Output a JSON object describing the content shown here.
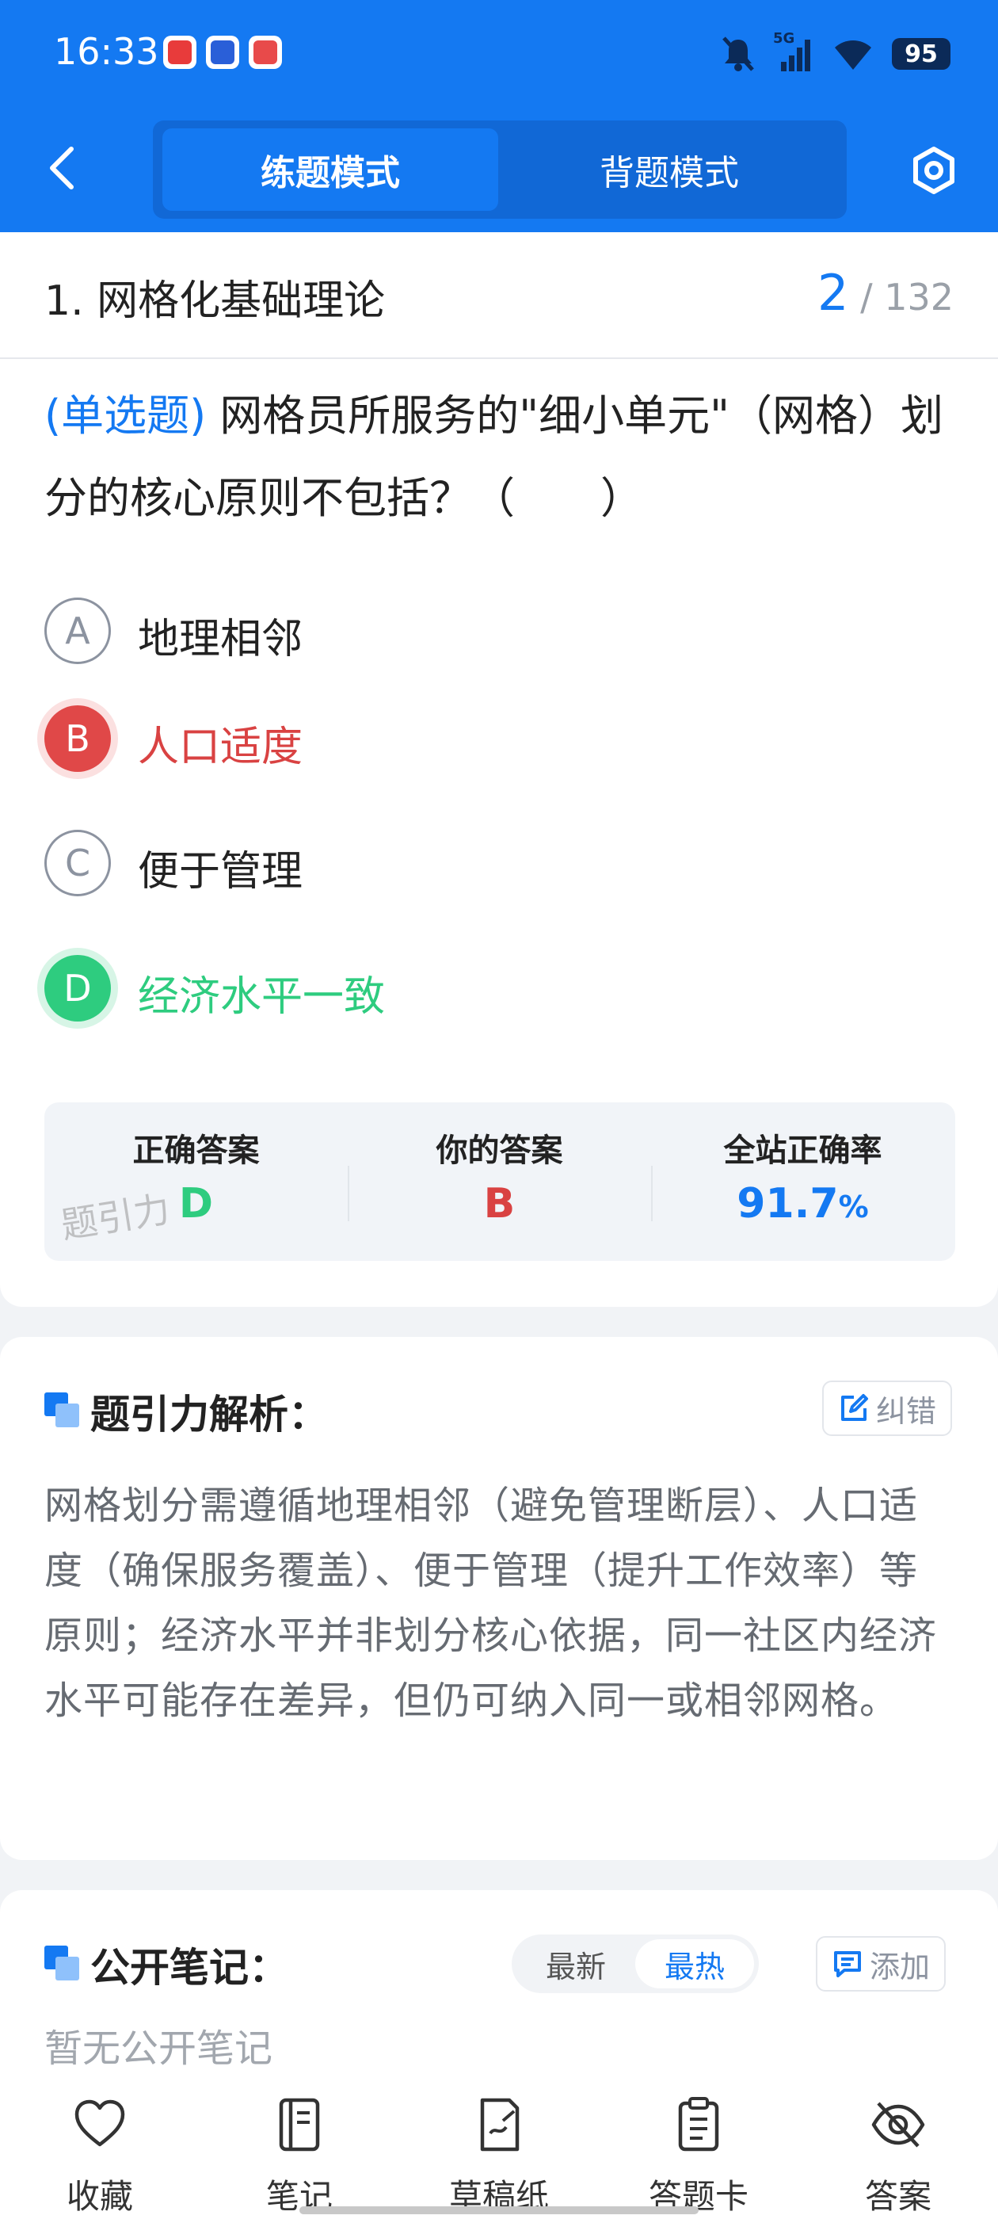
{
  "status_bar": {
    "time": "16:33",
    "network": "5G",
    "battery": "95"
  },
  "header": {
    "tabs": [
      "练题模式",
      "背题模式"
    ],
    "active_tab": "练题模式"
  },
  "section": {
    "title": "1. 网格化基础理论",
    "current": "2",
    "total": "132"
  },
  "question": {
    "type_label": "(单选题)",
    "text": "网格员所服务的\"细小单元\"（网格）划分的核心原则不包括？（　　）",
    "options": [
      {
        "letter": "A",
        "text": "地理相邻",
        "state": "normal"
      },
      {
        "letter": "B",
        "text": "人口适度",
        "state": "wrong"
      },
      {
        "letter": "C",
        "text": "便于管理",
        "state": "normal"
      },
      {
        "letter": "D",
        "text": "经济水平一致",
        "state": "correct"
      }
    ]
  },
  "answer_summary": {
    "correct_label": "正确答案",
    "correct_value": "D",
    "yours_label": "你的答案",
    "yours_value": "B",
    "rate_label": "全站正确率",
    "rate_value": "91.7",
    "rate_unit": "%",
    "watermark": "题引力"
  },
  "analysis": {
    "title": "题引力解析：",
    "report_button": "纠错",
    "text": "网格划分需遵循地理相邻（避免管理断层）、人口适度（确保服务覆盖）、便于管理（提升工作效率）等原则；经济水平并非划分核心依据，同一社区内经济水平可能存在差异，但仍可纳入同一或相邻网格。"
  },
  "notes": {
    "title": "公开笔记：",
    "sort_options": [
      "最新",
      "最热"
    ],
    "active_sort": "最热",
    "add_button": "添加",
    "empty_text": "暂无公开笔记"
  },
  "toolbar": {
    "items": [
      {
        "label": "收藏",
        "icon": "heart-icon"
      },
      {
        "label": "笔记",
        "icon": "notebook-icon"
      },
      {
        "label": "草稿纸",
        "icon": "draft-paper-icon"
      },
      {
        "label": "答题卡",
        "icon": "answer-sheet-icon"
      },
      {
        "label": "答案",
        "icon": "eye-off-icon"
      }
    ]
  },
  "colors": {
    "primary": "#1479f2",
    "wrong": "#e04848",
    "correct": "#2ecc7f"
  }
}
